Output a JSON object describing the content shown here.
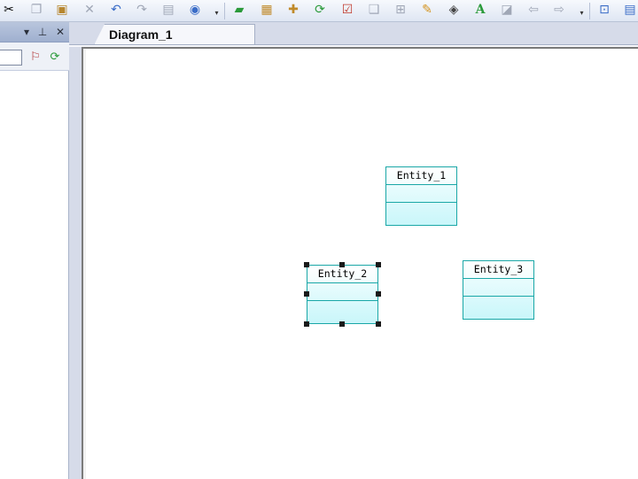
{
  "toolbar": {
    "groups": [
      {
        "icons": [
          "cut-icon",
          "copy-icon",
          "paste-icon",
          "delete-icon",
          "undo-icon",
          "redo-icon",
          "properties-icon",
          "find-icon"
        ]
      },
      {
        "icons": [
          "new-diagram-icon",
          "paste-special-icon",
          "add-icon",
          "refresh-icon",
          "checklist-icon",
          "frame-icon",
          "layout-icon",
          "brush-icon",
          "fill-icon",
          "font-icon",
          "shadow-icon",
          "back-icon",
          "forward-icon"
        ]
      },
      {
        "icons": [
          "model-icon"
        ]
      }
    ]
  },
  "left_panel": {
    "icons": [
      "dropdown-arrow-icon",
      "pin-icon",
      "close-icon",
      "filter-clear-icon",
      "refresh-icon"
    ]
  },
  "document": {
    "tab_label": "Diagram_1"
  },
  "diagram": {
    "entities": [
      {
        "name": "Entity_1",
        "selected": false
      },
      {
        "name": "Entity_2",
        "selected": true
      },
      {
        "name": "Entity_3",
        "selected": false
      }
    ]
  },
  "colors": {
    "entity_border": "#1aa7a7",
    "entity_fill": "#c9f6fa",
    "selection_handle": "#1a1a1a"
  }
}
